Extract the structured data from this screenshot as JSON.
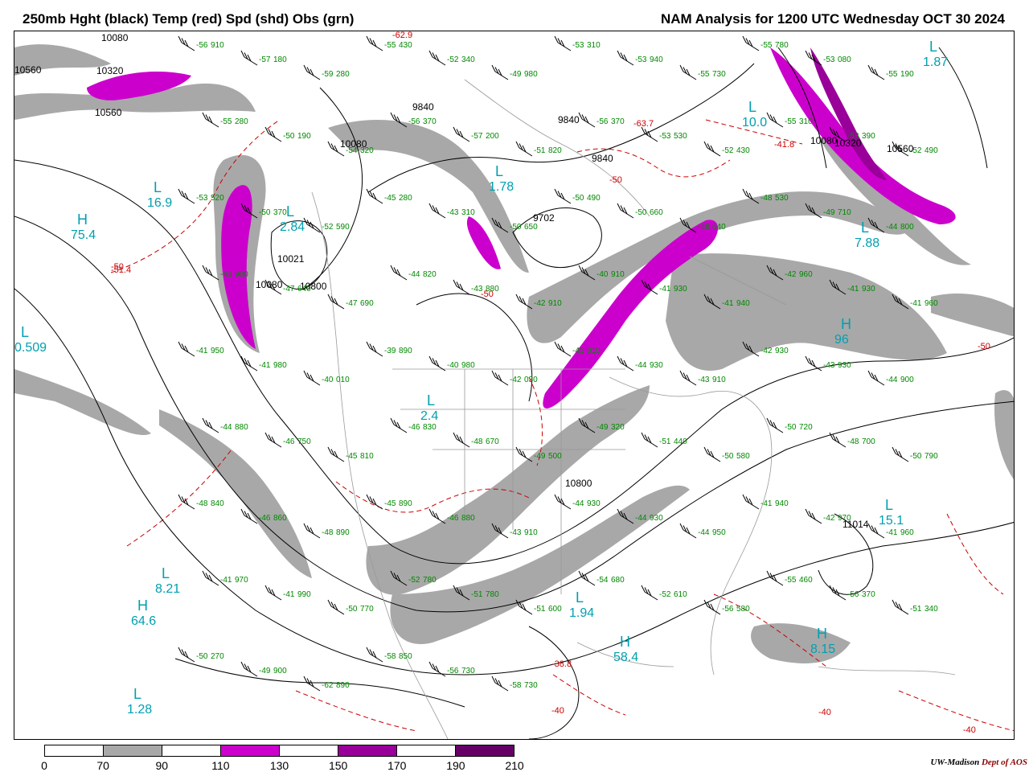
{
  "header": {
    "title_left": "250mb Hght (black) Temp (red) Spd (shd) Obs (grn)",
    "title_right": "NAM Analysis for 1200 UTC Wednesday  OCT 30 2024"
  },
  "colors": {
    "height_contour": "#000000",
    "temperature_contour": "#cc0000",
    "observation": "#008800",
    "center_label": "#00a0b0",
    "speed_70_90": "#a8a8a8",
    "speed_110_130": "#cc00cc",
    "speed_150_170": "#990099"
  },
  "legend": {
    "ticks": [
      "0",
      "70",
      "90",
      "110",
      "130",
      "150",
      "170",
      "190",
      "210"
    ],
    "colors": [
      "#ffffff",
      "#a8a8a8",
      "#ffffff",
      "#cc00cc",
      "#ffffff",
      "#990099",
      "#ffffff",
      "#660066"
    ]
  },
  "credit": {
    "org": "UW-Madison",
    "dept": "Dept of AOS"
  },
  "height_labels": [
    "10080",
    "10320",
    "10560",
    "10560",
    "10080",
    "9840",
    "9840",
    "9840",
    "10080",
    "10320",
    "10560",
    "9702",
    "10021",
    "10080",
    "10800",
    "10800",
    "11014"
  ],
  "pressure_centers": [
    {
      "letter": "L",
      "value": "1.87"
    },
    {
      "letter": "L",
      "value": "10.0"
    },
    {
      "letter": "L",
      "value": "1.78"
    },
    {
      "letter": "L",
      "value": "16.9"
    },
    {
      "letter": "H",
      "value": "75.4"
    },
    {
      "letter": "L",
      "value": "2.84"
    },
    {
      "letter": "L",
      "value": "0.509"
    },
    {
      "letter": "H",
      "value": "96"
    },
    {
      "letter": "L",
      "value": "2.4"
    },
    {
      "letter": "L",
      "value": "15.1"
    },
    {
      "letter": "L",
      "value": "8.21"
    },
    {
      "letter": "H",
      "value": "64.6"
    },
    {
      "letter": "L",
      "value": "1.94"
    },
    {
      "letter": "H",
      "value": "58.4"
    },
    {
      "letter": "L",
      "value": "1.28"
    },
    {
      "letter": "L",
      "value": "7.88"
    },
    {
      "letter": "H",
      "value": "8.15"
    }
  ],
  "temperature_labels": [
    "-62.9",
    "-51.4",
    "-50",
    "-63.7",
    "-41.8",
    "-50",
    "-50",
    "-38.8",
    "-40",
    "-40",
    "-40",
    "-50"
  ],
  "observations": [
    {
      "t": "-56",
      "h": "910"
    },
    {
      "t": "-57",
      "h": "180"
    },
    {
      "t": "-59",
      "h": "280"
    },
    {
      "t": "-55",
      "h": "430"
    },
    {
      "t": "-52",
      "h": "340"
    },
    {
      "t": "-49",
      "h": "980"
    },
    {
      "t": "-53",
      "h": "310"
    },
    {
      "t": "-53",
      "h": "940"
    },
    {
      "t": "-55",
      "h": "730"
    },
    {
      "t": "-55",
      "h": "780"
    },
    {
      "t": "-53",
      "h": "080"
    },
    {
      "t": "-55",
      "h": "190"
    },
    {
      "t": "-55",
      "h": "280"
    },
    {
      "t": "-50",
      "h": "190"
    },
    {
      "t": "-54",
      "h": "320"
    },
    {
      "t": "-56",
      "h": "370"
    },
    {
      "t": "-57",
      "h": "200"
    },
    {
      "t": "-51",
      "h": "820"
    },
    {
      "t": "-56",
      "h": "370"
    },
    {
      "t": "-53",
      "h": "530"
    },
    {
      "t": "-52",
      "h": "430"
    },
    {
      "t": "-55",
      "h": "310"
    },
    {
      "t": "-53",
      "h": "390"
    },
    {
      "t": "-52",
      "h": "490"
    },
    {
      "t": "-53",
      "h": "520"
    },
    {
      "t": "-50",
      "h": "370"
    },
    {
      "t": "-52",
      "h": "590"
    },
    {
      "t": "-45",
      "h": "280"
    },
    {
      "t": "-43",
      "h": "310"
    },
    {
      "t": "-50",
      "h": "650"
    },
    {
      "t": "-50",
      "h": "490"
    },
    {
      "t": "-50",
      "h": "660"
    },
    {
      "t": "-48",
      "h": "640"
    },
    {
      "t": "-48",
      "h": "530"
    },
    {
      "t": "-49",
      "h": "710"
    },
    {
      "t": "-44",
      "h": "800"
    },
    {
      "t": "-43",
      "h": "900"
    },
    {
      "t": "-47",
      "h": "640"
    },
    {
      "t": "-47",
      "h": "690"
    },
    {
      "t": "-44",
      "h": "820"
    },
    {
      "t": "-43",
      "h": "880"
    },
    {
      "t": "-42",
      "h": "910"
    },
    {
      "t": "-40",
      "h": "910"
    },
    {
      "t": "-41",
      "h": "930"
    },
    {
      "t": "-41",
      "h": "940"
    },
    {
      "t": "-42",
      "h": "960"
    },
    {
      "t": "-41",
      "h": "930"
    },
    {
      "t": "-41",
      "h": "960"
    },
    {
      "t": "-41",
      "h": "950"
    },
    {
      "t": "-41",
      "h": "980"
    },
    {
      "t": "-40",
      "h": "010"
    },
    {
      "t": "-39",
      "h": "890"
    },
    {
      "t": "-40",
      "h": "980"
    },
    {
      "t": "-42",
      "h": "030"
    },
    {
      "t": "-41",
      "h": "010"
    },
    {
      "t": "-44",
      "h": "930"
    },
    {
      "t": "-43",
      "h": "910"
    },
    {
      "t": "-42",
      "h": "930"
    },
    {
      "t": "-43",
      "h": "930"
    },
    {
      "t": "-44",
      "h": "900"
    },
    {
      "t": "-44",
      "h": "880"
    },
    {
      "t": "-46",
      "h": "750"
    },
    {
      "t": "-45",
      "h": "810"
    },
    {
      "t": "-46",
      "h": "830"
    },
    {
      "t": "-48",
      "h": "670"
    },
    {
      "t": "-49",
      "h": "500"
    },
    {
      "t": "-49",
      "h": "320"
    },
    {
      "t": "-51",
      "h": "440"
    },
    {
      "t": "-50",
      "h": "580"
    },
    {
      "t": "-50",
      "h": "720"
    },
    {
      "t": "-48",
      "h": "700"
    },
    {
      "t": "-50",
      "h": "790"
    },
    {
      "t": "-48",
      "h": "840"
    },
    {
      "t": "-46",
      "h": "860"
    },
    {
      "t": "-48",
      "h": "890"
    },
    {
      "t": "-45",
      "h": "890"
    },
    {
      "t": "-46",
      "h": "880"
    },
    {
      "t": "-43",
      "h": "910"
    },
    {
      "t": "-44",
      "h": "930"
    },
    {
      "t": "-44",
      "h": "930"
    },
    {
      "t": "-44",
      "h": "950"
    },
    {
      "t": "-41",
      "h": "940"
    },
    {
      "t": "-42",
      "h": "970"
    },
    {
      "t": "-41",
      "h": "960"
    },
    {
      "t": "-41",
      "h": "970"
    },
    {
      "t": "-41",
      "h": "990"
    },
    {
      "t": "-50",
      "h": "770"
    },
    {
      "t": "-52",
      "h": "780"
    },
    {
      "t": "-51",
      "h": "780"
    },
    {
      "t": "-51",
      "h": "600"
    },
    {
      "t": "-54",
      "h": "680"
    },
    {
      "t": "-52",
      "h": "610"
    },
    {
      "t": "-56",
      "h": "580"
    },
    {
      "t": "-55",
      "h": "460"
    },
    {
      "t": "-56",
      "h": "370"
    },
    {
      "t": "-51",
      "h": "340"
    },
    {
      "t": "-50",
      "h": "270"
    },
    {
      "t": "-49",
      "h": "900"
    },
    {
      "t": "-62",
      "h": "890"
    },
    {
      "t": "-58",
      "h": "850"
    },
    {
      "t": "-56",
      "h": "730"
    },
    {
      "t": "-58",
      "h": "730"
    }
  ]
}
